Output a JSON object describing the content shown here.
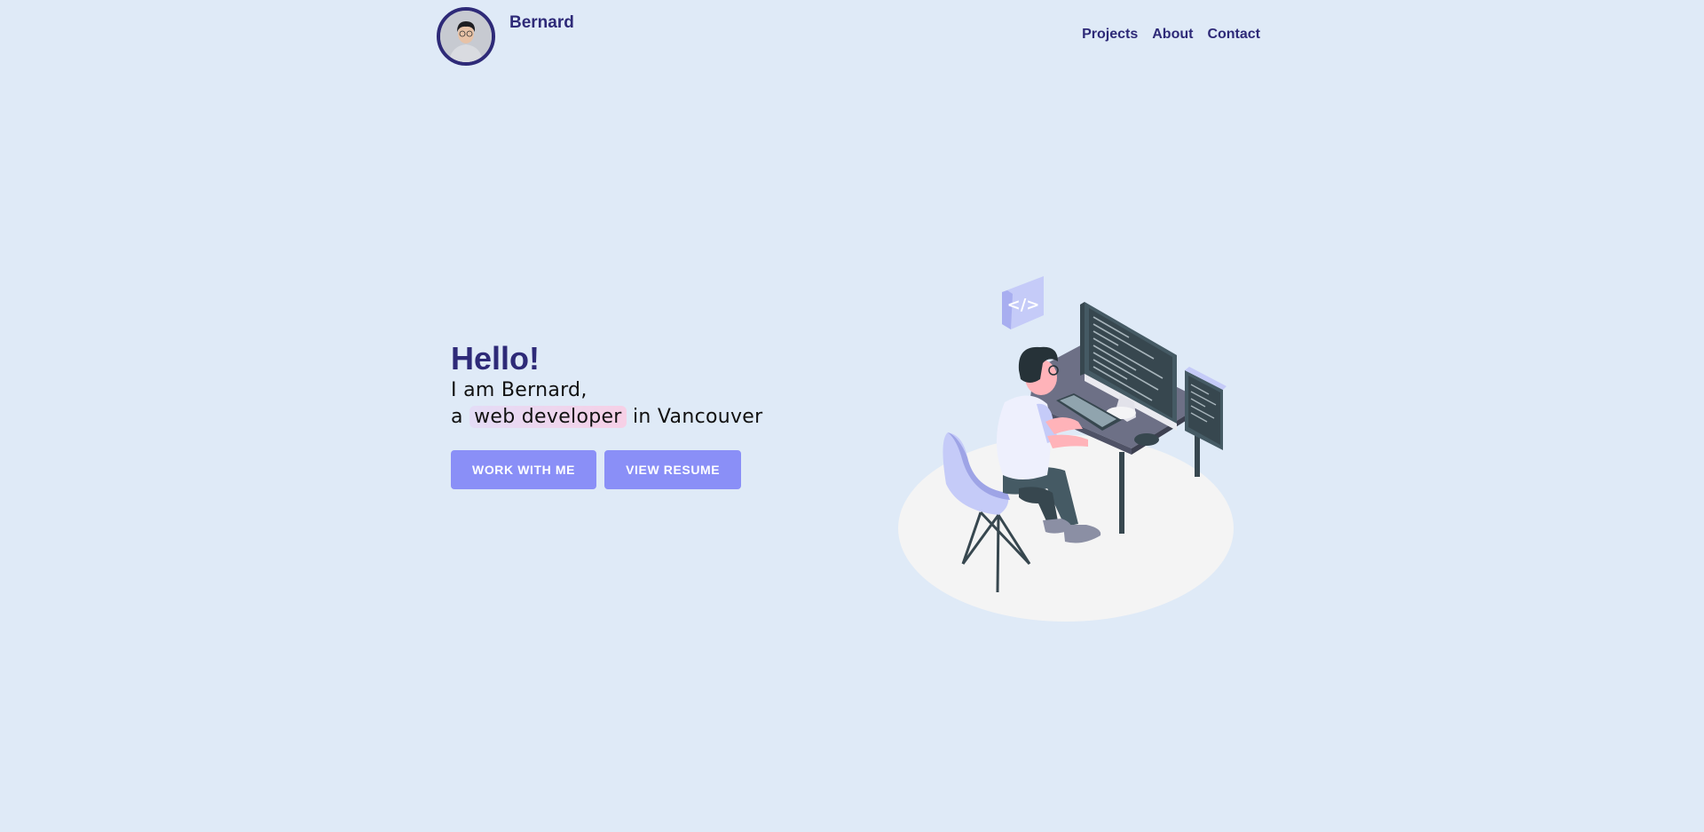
{
  "header": {
    "brand_name": "Bernard",
    "nav": [
      {
        "label": "Projects"
      },
      {
        "label": "About"
      },
      {
        "label": "Contact"
      }
    ]
  },
  "hero": {
    "greeting": "Hello!",
    "line1": "I am Bernard,",
    "line2_prefix": "a",
    "line2_highlight": "web developer",
    "line2_suffix": "in Vancouver",
    "buttons": {
      "work_with_me": "WORK WITH ME",
      "view_resume": "VIEW RESUME"
    }
  },
  "illustration": {
    "code_badge": "</>"
  },
  "colors": {
    "background": "#dfeaf7",
    "brand": "#2e2a78",
    "button": "#8a8ff7",
    "highlight": "#f6d0e6"
  }
}
